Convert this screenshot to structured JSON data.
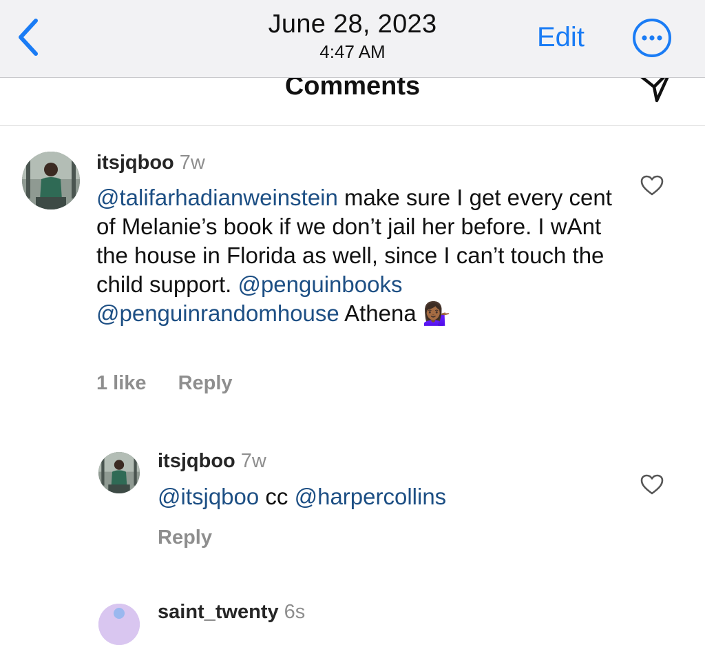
{
  "topbar": {
    "date": "June 28, 2023",
    "time": "4:47 AM",
    "edit_label": "Edit",
    "accent_color": "#1a7cf5"
  },
  "comments_header": {
    "title": "Comments"
  },
  "comments": [
    {
      "username": "itsjqboo",
      "age": "7w",
      "text_parts": {
        "m1": "@talifarhadianweinstein",
        "t1": " make sure I get every cent of Melanie’s book if we don’t jail her before. I wAnt the house in Florida as well, since I can’t touch the child support. ",
        "m2": "@penguinbooks",
        "t2": " ",
        "m3": "@penguinrandomhouse",
        "t3": " Athena ",
        "emoji": "💁🏾‍♀️"
      },
      "likes": "1 like",
      "reply_label": "Reply"
    },
    {
      "username": "itsjqboo",
      "age": "7w",
      "text_parts": {
        "m1": "@itsjqboo",
        "t1": " cc ",
        "m2": "@harpercollins"
      },
      "reply_label": "Reply"
    },
    {
      "username": "saint_twenty",
      "age": "6s"
    }
  ],
  "colors": {
    "mention": "#1d4f84",
    "muted": "#8e8e8e"
  }
}
